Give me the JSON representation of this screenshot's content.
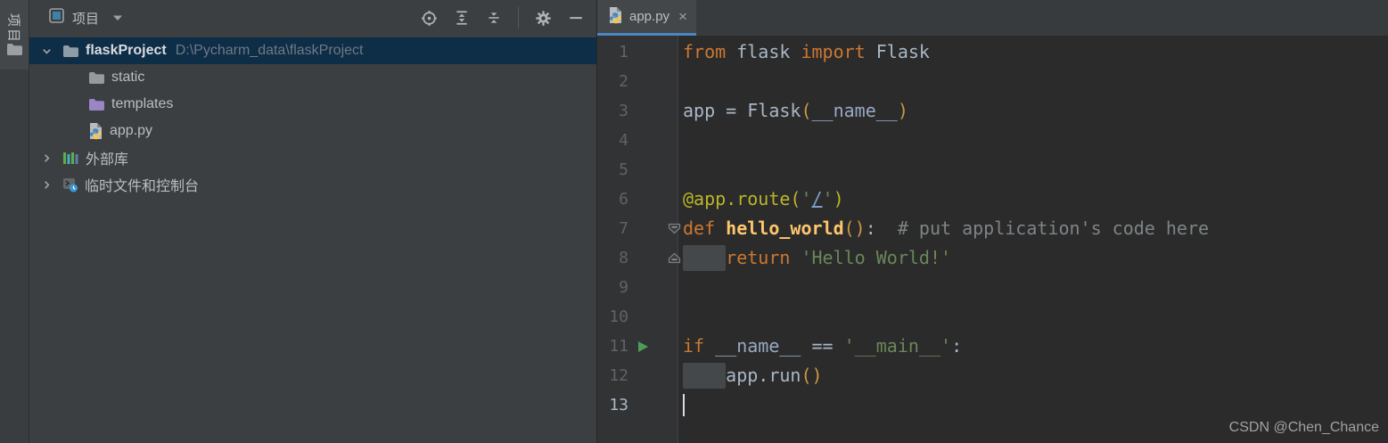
{
  "stripe": {
    "project_label": "项目"
  },
  "panel": {
    "title": "项目",
    "toolbar": [
      {
        "name": "locate",
        "icon": "locate-icon"
      },
      {
        "name": "expand-all",
        "icon": "expand-all-icon"
      },
      {
        "name": "collapse-all",
        "icon": "collapse-all-icon"
      },
      {
        "name": "separator",
        "icon": "separator"
      },
      {
        "name": "settings",
        "icon": "gear-icon"
      },
      {
        "name": "hide",
        "icon": "hide-icon"
      }
    ],
    "tree": [
      {
        "id": "flaskProject",
        "label": "flaskProject",
        "path": "D:\\Pycharm_data\\flaskProject",
        "icon": "folder",
        "folder_color": "#8E9BA8",
        "chevron": "down",
        "level": 0,
        "selected": true,
        "bold": true
      },
      {
        "id": "static",
        "label": "static",
        "icon": "folder",
        "folder_color": "#96999D",
        "level": 1
      },
      {
        "id": "templates",
        "label": "templates",
        "icon": "folder",
        "folder_color": "#9B86C5",
        "level": 1
      },
      {
        "id": "app-py",
        "label": "app.py",
        "icon": "python-file",
        "level": 1
      },
      {
        "id": "external-libraries",
        "label": "外部库",
        "icon": "libraries",
        "chevron": "right",
        "level": 0
      },
      {
        "id": "scratches",
        "label": "临时文件和控制台",
        "icon": "scratches",
        "chevron": "right",
        "level": 0
      }
    ]
  },
  "editor": {
    "tab": {
      "label": "app.py",
      "close_label": "×"
    },
    "watermark": "CSDN @Chen_Chance",
    "lines": [
      {
        "n": 1,
        "tokens": [
          {
            "c": "kw",
            "t": "from"
          },
          {
            "c": "txt",
            "t": " flask "
          },
          {
            "c": "kw",
            "t": "import"
          },
          {
            "c": "txt",
            "t": " Flask"
          }
        ]
      },
      {
        "n": 2,
        "tokens": []
      },
      {
        "n": 3,
        "tokens": [
          {
            "c": "txt",
            "t": "app = Flask"
          },
          {
            "c": "br",
            "t": "("
          },
          {
            "c": "dun",
            "t": "__name__"
          },
          {
            "c": "br",
            "t": ")"
          }
        ]
      },
      {
        "n": 4,
        "tokens": []
      },
      {
        "n": 5,
        "tokens": []
      },
      {
        "n": 6,
        "tokens": [
          {
            "c": "deco",
            "t": "@app.route("
          },
          {
            "c": "str",
            "t": "'"
          },
          {
            "c": "link",
            "t": "/"
          },
          {
            "c": "str",
            "t": "'"
          },
          {
            "c": "deco",
            "t": ")"
          }
        ]
      },
      {
        "n": 7,
        "fold": "top",
        "tokens": [
          {
            "c": "kw",
            "t": "def "
          },
          {
            "c": "fn",
            "t": "hello_world"
          },
          {
            "c": "br",
            "t": "()"
          },
          {
            "c": "txt",
            "t": ":  "
          },
          {
            "c": "cmt",
            "t": "# put application's code here"
          }
        ]
      },
      {
        "n": 8,
        "fold": "bottom",
        "indent_block": true,
        "tokens": [
          {
            "c": "txt",
            "t": "    "
          },
          {
            "c": "kw",
            "t": "return"
          },
          {
            "c": "txt",
            "t": " "
          },
          {
            "c": "str",
            "t": "'Hello World!'"
          }
        ]
      },
      {
        "n": 9,
        "tokens": []
      },
      {
        "n": 10,
        "tokens": []
      },
      {
        "n": 11,
        "run": true,
        "tokens": [
          {
            "c": "kw",
            "t": "if"
          },
          {
            "c": "txt",
            "t": " "
          },
          {
            "c": "dun",
            "t": "__name__"
          },
          {
            "c": "txt",
            "t": " == "
          },
          {
            "c": "str",
            "t": "'__main__'"
          },
          {
            "c": "txt",
            "t": ":"
          }
        ]
      },
      {
        "n": 12,
        "indent_block": true,
        "tokens": [
          {
            "c": "txt",
            "t": "    "
          },
          {
            "c": "txt",
            "t": "app.run"
          },
          {
            "c": "br",
            "t": "()"
          }
        ]
      },
      {
        "n": 13,
        "caret": true,
        "tokens": []
      }
    ]
  },
  "colors": {
    "editor_bg": "#2B2B2B",
    "panel_bg": "#3C3F41",
    "gutter_bg": "#313335",
    "selection_bg": "#0E2D47",
    "tab_underline": "#4A88C2",
    "keyword": "#CC7832",
    "string": "#6A8759",
    "comment": "#7E8487",
    "function": "#FFC66D",
    "decorator": "#BBB529",
    "default_text": "#A9B7C6",
    "dunder": "#97A9C2",
    "bracket": "#CB9840",
    "link": "#7EA0C8",
    "line_number": "#606366",
    "run_icon": "#4C9E54",
    "templates_folder": "#9B86C5"
  }
}
